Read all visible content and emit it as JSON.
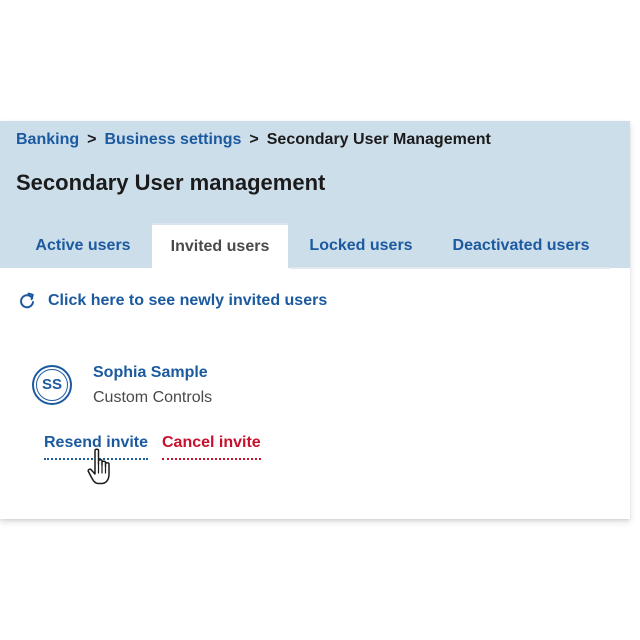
{
  "breadcrumb": {
    "items": [
      "Banking",
      "Business settings"
    ],
    "separator": ">",
    "current": "Secondary User Management"
  },
  "page_title": "Secondary User management",
  "tabs": [
    {
      "label": "Active users",
      "active": false
    },
    {
      "label": "Invited users",
      "active": true
    },
    {
      "label": "Locked users",
      "active": false
    },
    {
      "label": "Deactivated users",
      "active": false
    }
  ],
  "refresh": {
    "icon": "refresh-icon",
    "label": "Click here to see newly invited users"
  },
  "user": {
    "initials": "SS",
    "name": "Sophia Sample",
    "subtitle": "Custom Controls"
  },
  "actions": {
    "resend_label": "Resend invite",
    "cancel_label": "Cancel invite"
  },
  "colors": {
    "link_blue": "#1c5aa0",
    "danger_red": "#c8102e",
    "header_bg": "#cddeeb",
    "text_dark": "#1b1b1b"
  },
  "cursor": "hand-pointer-icon"
}
